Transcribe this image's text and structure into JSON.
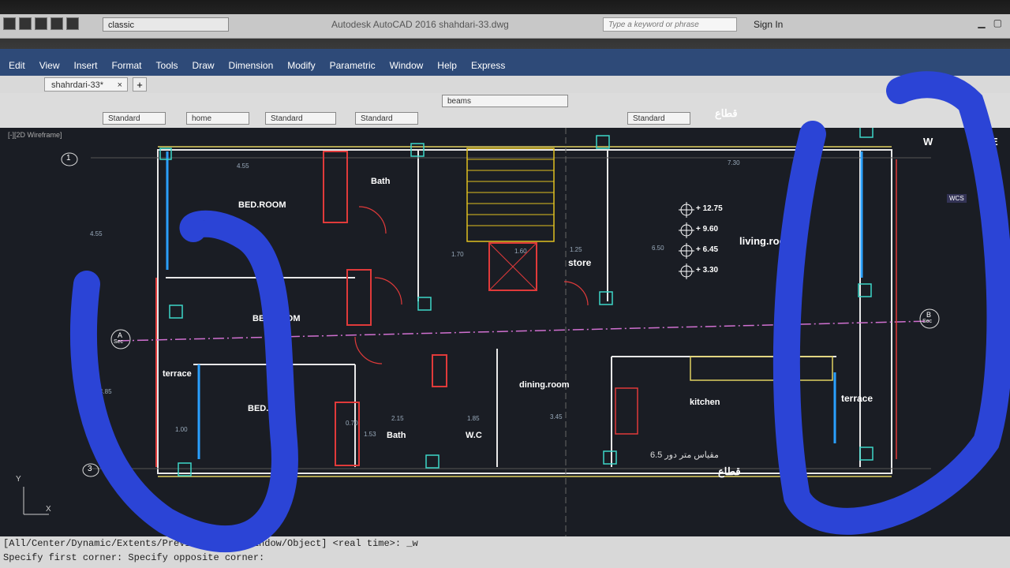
{
  "app": {
    "title": "Autodesk AutoCAD 2016   shahdari-33.dwg"
  },
  "workspace": {
    "value": "classic"
  },
  "search": {
    "placeholder": "Type a keyword or phrase"
  },
  "account": {
    "signin": "Sign In"
  },
  "menu": [
    "Edit",
    "View",
    "Insert",
    "Format",
    "Tools",
    "Draw",
    "Dimension",
    "Modify",
    "Parametric",
    "Window",
    "Help",
    "Express"
  ],
  "doc_tab": {
    "label": "shahrdari-33*",
    "close": "×",
    "new": "+"
  },
  "toolbars": {
    "layer_value": "beams",
    "text_style": "Standard",
    "dim_style": "Standard",
    "table_style": "Standard",
    "multileader_style": "Standard",
    "annot_style": "Standard",
    "home_combo": "home",
    "style4": "Standard"
  },
  "viewport": {
    "label": "[-][2D Wireframe]"
  },
  "view_cube": {
    "w": "W",
    "e": "E",
    "wcs": "WCS"
  },
  "plan": {
    "rooms": {
      "bed1": "BED.ROOM",
      "bed2": "BED.ROOM",
      "bed3": "BED.",
      "bath1": "Bath",
      "bath2": "Bath",
      "wc": "W.C",
      "store": "store",
      "living": "living.room",
      "dining": "dining.room",
      "kitchen": "kitchen",
      "terrace_left": "terrace",
      "terrace_right": "terrace"
    },
    "levels": [
      "+ 12.75",
      "+ 9.60",
      "+ 6.45",
      "+ 3.30"
    ],
    "grid_marks": {
      "g1": "1",
      "g3": "3",
      "secA": "A",
      "secB": "B",
      "sec": "Sec"
    },
    "section_title_top": "قطاع",
    "section_title_bottom": "قطاع",
    "scale_note": "6.5 مقياس متر دور",
    "dims": [
      "4.55",
      "1.70",
      "1.60",
      "1.25",
      "6.50",
      "7.30",
      "4.55",
      "4.85",
      "2.15",
      "1.85",
      "3.45",
      "0.70",
      "1.53",
      "1.00"
    ]
  },
  "command": {
    "line1": "[All/Center/Dynamic/Extents/Previous/Scale/Window/Object] <real time>: _w",
    "line2": "Specify first corner: Specify opposite corner:"
  },
  "colors": {
    "annotation": "#2b44d6",
    "menubar": "#2e4a78",
    "canvas": "#1a1d24"
  }
}
